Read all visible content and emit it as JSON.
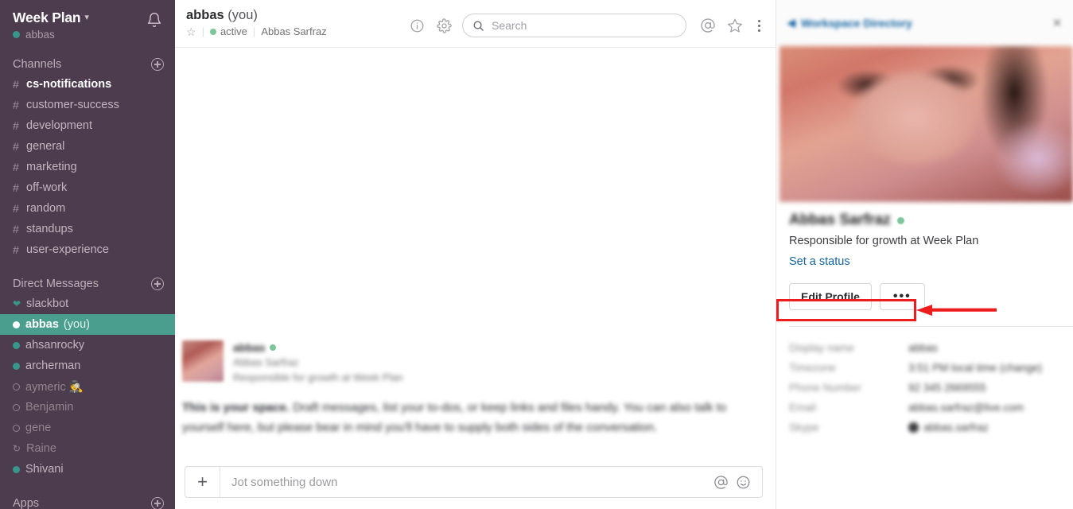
{
  "workspace": {
    "name": "Week Plan",
    "caret_icon": "chevron-down-icon",
    "bell_icon": "bell-icon",
    "current_user": "abbas"
  },
  "sidebar": {
    "channels_section": {
      "label": "Channels",
      "add_icon": "plus-circle-icon",
      "items": [
        {
          "sym": "#",
          "name": "cs-notifications",
          "style": "unread"
        },
        {
          "sym": "#",
          "name": "customer-success",
          "style": "normal"
        },
        {
          "sym": "#",
          "name": "development",
          "style": "normal"
        },
        {
          "sym": "#",
          "name": "general",
          "style": "normal"
        },
        {
          "sym": "#",
          "name": "marketing",
          "style": "normal"
        },
        {
          "sym": "#",
          "name": "off-work",
          "style": "normal"
        },
        {
          "sym": "#",
          "name": "random",
          "style": "normal"
        },
        {
          "sym": "#",
          "name": "standups",
          "style": "normal"
        },
        {
          "sym": "#",
          "name": "user-experience",
          "style": "normal"
        }
      ]
    },
    "dms_section": {
      "label": "Direct Messages",
      "add_icon": "plus-circle-icon",
      "items": [
        {
          "icon": "heart-icon",
          "name": "slackbot",
          "suffix": "",
          "state": "bot"
        },
        {
          "icon": "presence-online-icon",
          "name": "abbas",
          "suffix": "(you)",
          "state": "active-selected"
        },
        {
          "icon": "presence-online-icon",
          "name": "ahsanrocky",
          "suffix": "",
          "state": "online"
        },
        {
          "icon": "presence-online-icon",
          "name": "archerman",
          "suffix": "",
          "state": "online"
        },
        {
          "icon": "presence-away-icon",
          "name": "aymeric  🕵",
          "suffix": "",
          "state": "away"
        },
        {
          "icon": "presence-away-icon",
          "name": "Benjamin",
          "suffix": "",
          "state": "away"
        },
        {
          "icon": "presence-away-icon",
          "name": "gene",
          "suffix": "",
          "state": "away"
        },
        {
          "icon": "presence-dnd-icon",
          "name": "Raine",
          "suffix": "",
          "state": "away"
        },
        {
          "icon": "presence-online-icon",
          "name": "Shivani",
          "suffix": "",
          "state": "online"
        }
      ]
    },
    "apps_section": {
      "label": "Apps",
      "add_icon": "plus-circle-icon"
    }
  },
  "topbar": {
    "title_name": "abbas",
    "title_suffix": "(you)",
    "star_icon": "star-outline-icon",
    "presence_label": "active",
    "full_name": "Abbas Sarfraz",
    "info_icon": "info-circle-icon",
    "gear_icon": "gear-icon",
    "search": {
      "icon": "search-icon",
      "placeholder": "Search",
      "value": ""
    },
    "mentions_icon": "at-mention-icon",
    "starred_icon": "star-outline-icon",
    "more_icon": "kebab-menu-icon"
  },
  "message": {
    "author": "abbas",
    "author_presence_icon": "presence-online-icon",
    "full_name": "Abbas Sarfraz",
    "title": "Responsible for growth at Week Plan",
    "body_bold": "This is your space.",
    "body_rest": " Draft messages, list your to-dos, or keep links and files handy. You can also talk to yourself here, but please bear in mind you'll have to supply both sides of the conversation."
  },
  "composer": {
    "add_icon": "plus-icon",
    "placeholder": "Jot something down",
    "value": "",
    "mention_icon": "at-mention-icon",
    "emoji_icon": "emoji-smiley-icon"
  },
  "right_panel": {
    "back_label": "Workspace Directory",
    "back_icon": "chevron-left-icon",
    "close_icon": "close-icon",
    "photo_alt": "profile-photo",
    "name": "Abbas Sarfraz",
    "presence_icon": "presence-online-icon",
    "description": "Responsible for growth at Week Plan",
    "status_link": "Set a status",
    "edit_profile_label": "Edit Profile",
    "more_label": "•••",
    "fields": [
      {
        "label": "Display name",
        "value": "abbas"
      },
      {
        "label": "Timezone",
        "value": "3:51 PM local time (change)"
      },
      {
        "label": "Phone Number",
        "value": "92 345 2669555"
      },
      {
        "label": "Email",
        "value": "abbas.sarfraz@live.com"
      },
      {
        "label": "Skype",
        "value": "abbas.sarfraz",
        "icon": "skype-icon"
      }
    ]
  },
  "annotation": {
    "highlight_target": "Set a status",
    "color": "#ee1d1d",
    "arrow_direction": "left"
  }
}
